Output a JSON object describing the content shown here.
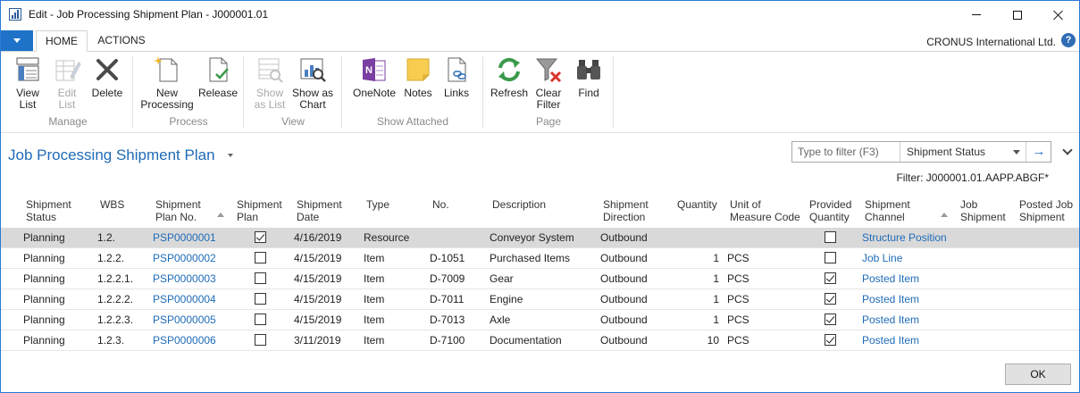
{
  "window": {
    "title": "Edit - Job Processing Shipment Plan - J000001.01",
    "company": "CRONUS International Ltd.",
    "help": "?"
  },
  "tabs": [
    {
      "label": "HOME"
    },
    {
      "label": "ACTIONS"
    }
  ],
  "ribbon": {
    "groups": [
      {
        "label": "Manage"
      },
      {
        "label": "Process"
      },
      {
        "label": "View"
      },
      {
        "label": "Show Attached"
      },
      {
        "label": "Page"
      }
    ],
    "buttons": [
      {
        "line1": "View",
        "line2": "List"
      },
      {
        "line1": "Edit",
        "line2": "List"
      },
      {
        "line1": "Delete",
        "line2": ""
      },
      {
        "line1": "New",
        "line2": "Processing"
      },
      {
        "line1": "Release",
        "line2": ""
      },
      {
        "line1": "Show",
        "line2": "as List"
      },
      {
        "line1": "Show as",
        "line2": "Chart"
      },
      {
        "line1": "OneNote",
        "line2": ""
      },
      {
        "line1": "Notes",
        "line2": ""
      },
      {
        "line1": "Links",
        "line2": ""
      },
      {
        "line1": "Refresh",
        "line2": ""
      },
      {
        "line1": "Clear",
        "line2": "Filter"
      },
      {
        "line1": "Find",
        "line2": ""
      }
    ]
  },
  "page": {
    "title": "Job Processing Shipment Plan",
    "filter_placeholder": "Type to filter (F3)",
    "filter_field": "Shipment Status",
    "filter_text": "Filter: J000001.01.AAPP.ABGF*"
  },
  "columns": [
    {
      "l1": "Shipment",
      "l2": "Status"
    },
    {
      "l1": "WBS",
      "l2": ""
    },
    {
      "l1": "Shipment",
      "l2": "Plan No."
    },
    {
      "l1": "Shipment",
      "l2": "Plan"
    },
    {
      "l1": "Shipment",
      "l2": "Date"
    },
    {
      "l1": "Type",
      "l2": ""
    },
    {
      "l1": "No.",
      "l2": ""
    },
    {
      "l1": "Description",
      "l2": ""
    },
    {
      "l1": "Shipment",
      "l2": "Direction"
    },
    {
      "l1": "Quantity",
      "l2": ""
    },
    {
      "l1": "Unit of",
      "l2": "Measure Code"
    },
    {
      "l1": "Provided",
      "l2": "Quantity"
    },
    {
      "l1": "Shipment",
      "l2": "Channel"
    },
    {
      "l1": "Job",
      "l2": "Shipment"
    },
    {
      "l1": "Posted Job",
      "l2": "Shipment"
    }
  ],
  "rows": [
    {
      "status": "Planning",
      "wbs": "1.2.",
      "plan_no": "PSP0000001",
      "plan": true,
      "date": "4/16/2019",
      "type": "Resource",
      "no": "",
      "description": "Conveyor System",
      "direction": "Outbound",
      "quantity": "",
      "uom": "",
      "provided": false,
      "channel": "Structure Position"
    },
    {
      "status": "Planning",
      "wbs": "1.2.2.",
      "plan_no": "PSP0000002",
      "plan": false,
      "date": "4/15/2019",
      "type": "Item",
      "no": "D-1051",
      "description": "Purchased Items",
      "direction": "Outbound",
      "quantity": "1",
      "uom": "PCS",
      "provided": false,
      "channel": "Job Line"
    },
    {
      "status": "Planning",
      "wbs": "1.2.2.1.",
      "plan_no": "PSP0000003",
      "plan": false,
      "date": "4/15/2019",
      "type": "Item",
      "no": "D-7009",
      "description": "Gear",
      "direction": "Outbound",
      "quantity": "1",
      "uom": "PCS",
      "provided": true,
      "channel": "Posted Item"
    },
    {
      "status": "Planning",
      "wbs": "1.2.2.2.",
      "plan_no": "PSP0000004",
      "plan": false,
      "date": "4/15/2019",
      "type": "Item",
      "no": "D-7011",
      "description": "Engine",
      "direction": "Outbound",
      "quantity": "1",
      "uom": "PCS",
      "provided": true,
      "channel": "Posted Item"
    },
    {
      "status": "Planning",
      "wbs": "1.2.2.3.",
      "plan_no": "PSP0000005",
      "plan": false,
      "date": "4/15/2019",
      "type": "Item",
      "no": "D-7013",
      "description": "Axle",
      "direction": "Outbound",
      "quantity": "1",
      "uom": "PCS",
      "provided": true,
      "channel": "Posted Item"
    },
    {
      "status": "Planning",
      "wbs": "1.2.3.",
      "plan_no": "PSP0000006",
      "plan": false,
      "date": "3/11/2019",
      "type": "Item",
      "no": "D-7100",
      "description": "Documentation",
      "direction": "Outbound",
      "quantity": "10",
      "uom": "PCS",
      "provided": true,
      "channel": "Posted Item"
    }
  ],
  "footer": {
    "ok_label": "OK"
  }
}
